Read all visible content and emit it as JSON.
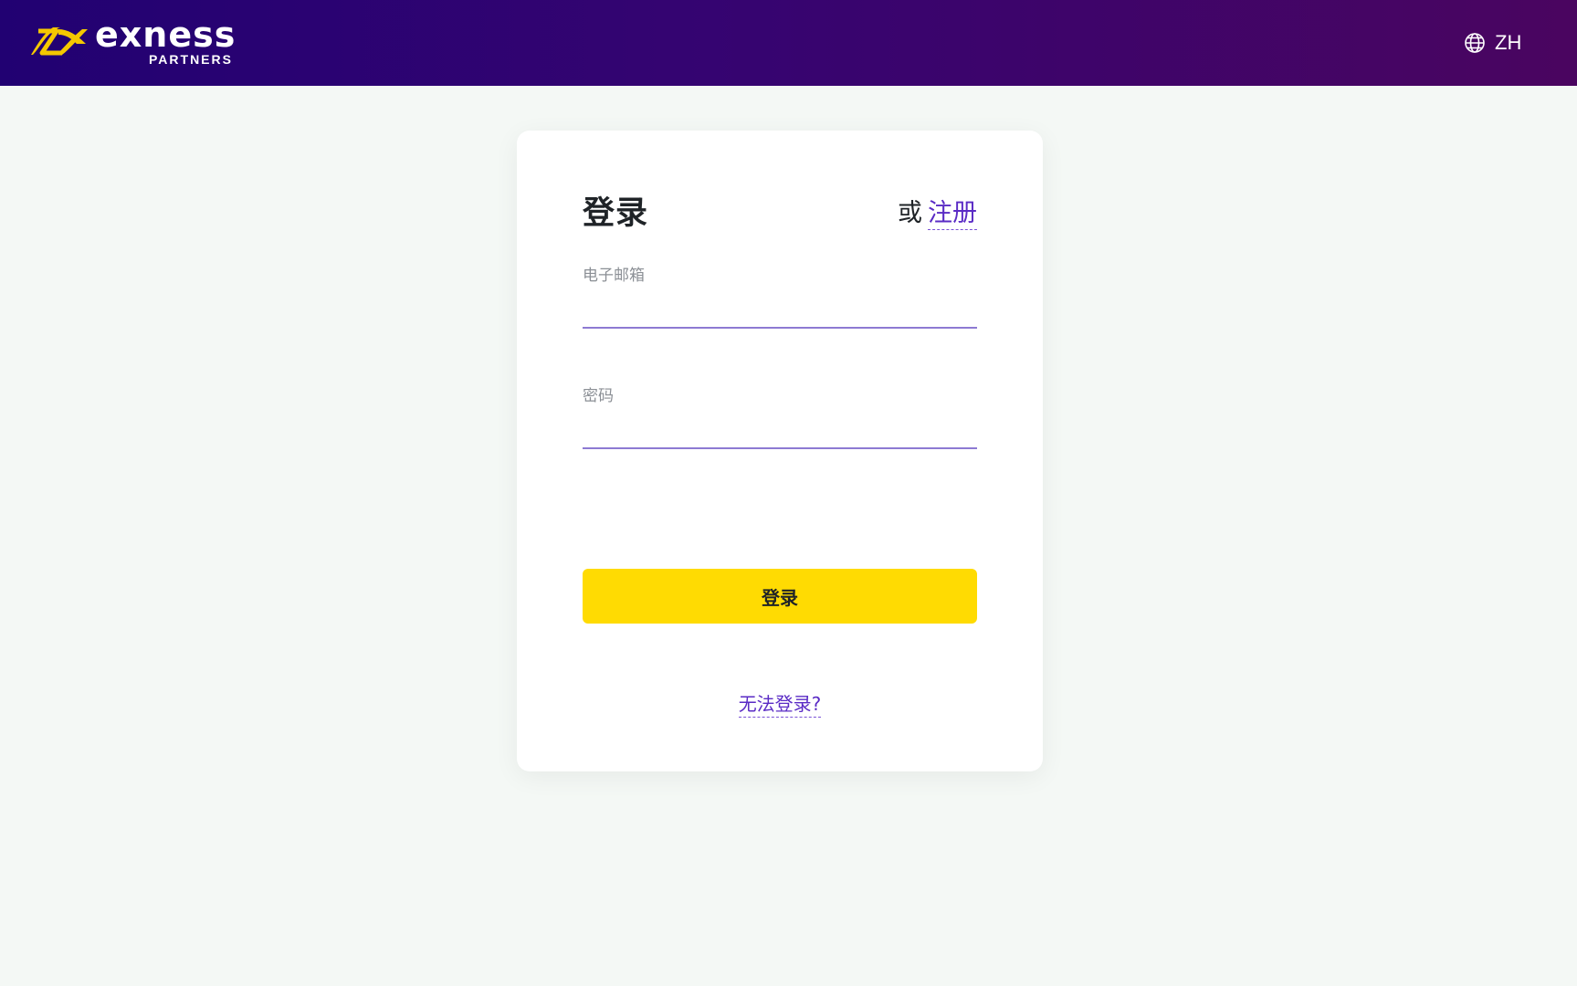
{
  "header": {
    "logo_word": "exness",
    "logo_sub": "PARTNERS",
    "language": "ZH"
  },
  "login": {
    "title": "登录",
    "or_text": "或",
    "register_link": "注册",
    "email_label": "电子邮箱",
    "email_value": "",
    "password_label": "密码",
    "password_value": "",
    "submit_label": "登录",
    "trouble_link": "无法登录?"
  },
  "colors": {
    "header_start": "#210172",
    "header_end": "#4a0560",
    "accent": "#5a2bc5",
    "button": "#ffdb02",
    "page_bg": "#f4f8f5"
  },
  "icons": {
    "language": "globe-icon",
    "logo": "exness-logo-mark"
  }
}
